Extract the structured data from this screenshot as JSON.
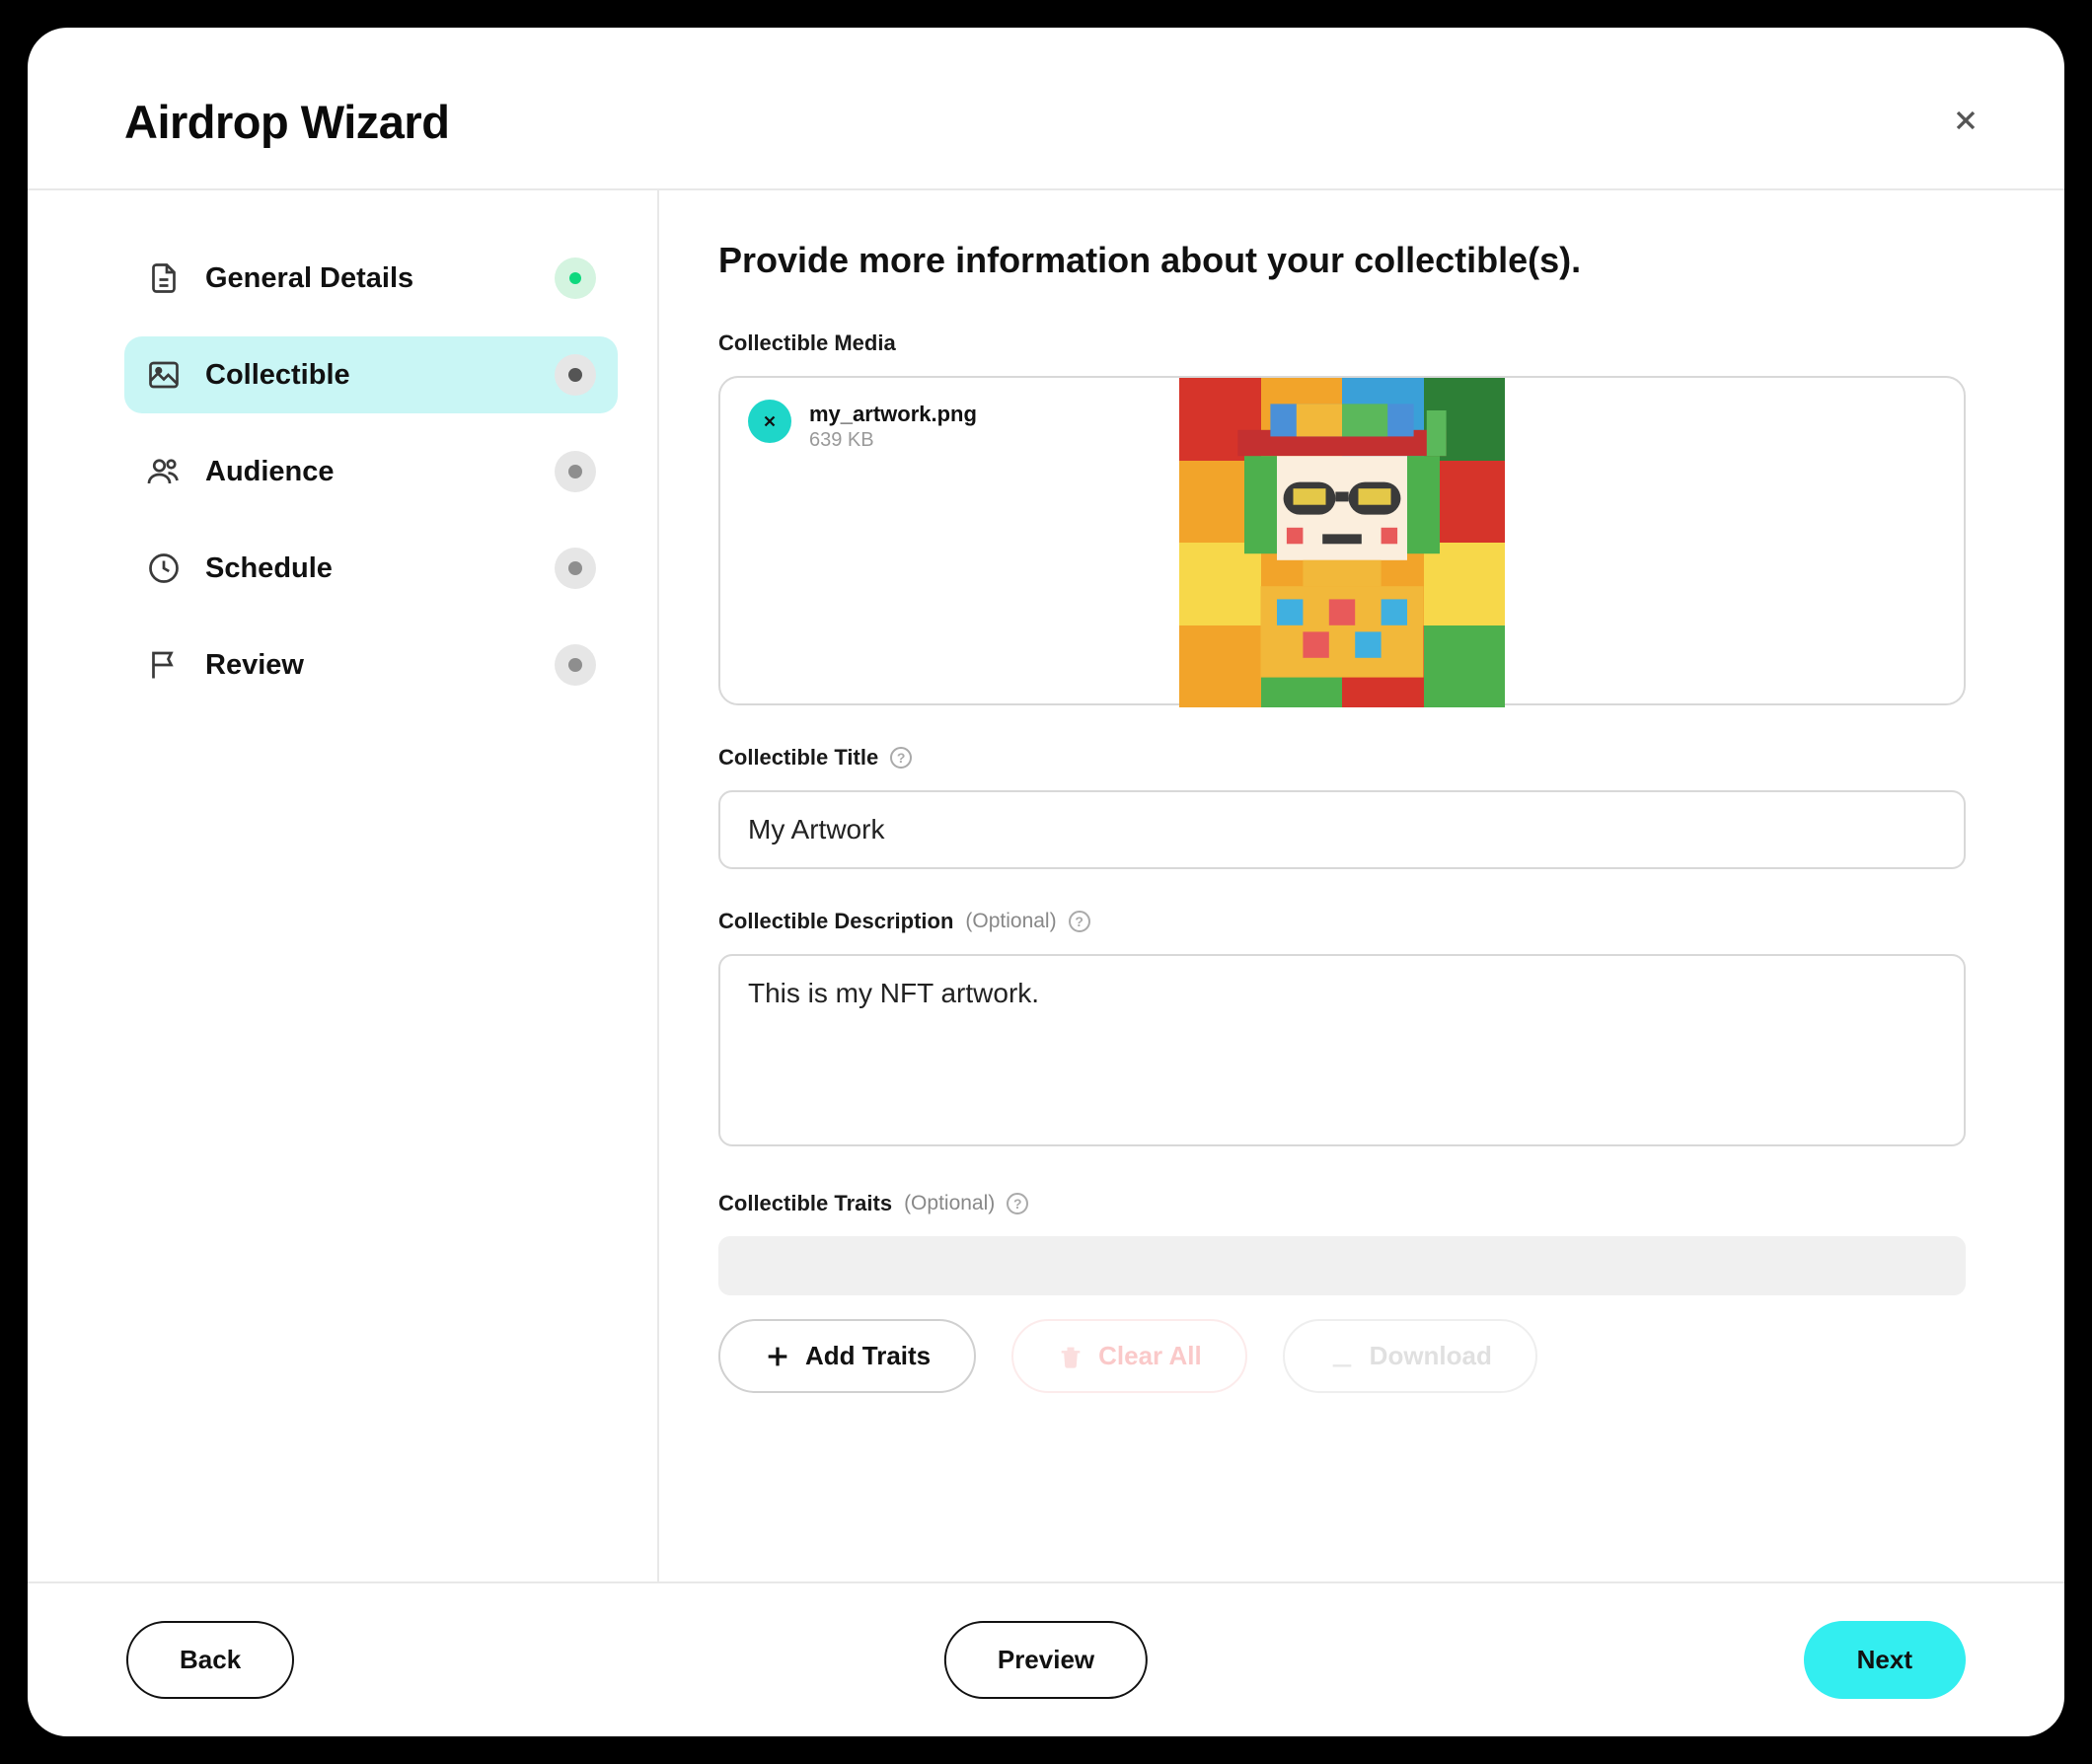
{
  "modal": {
    "title": "Airdrop Wizard"
  },
  "sidebar": {
    "steps": [
      {
        "label": "General Details",
        "status": "complete"
      },
      {
        "label": "Collectible",
        "status": "active"
      },
      {
        "label": "Audience",
        "status": "pending"
      },
      {
        "label": "Schedule",
        "status": "pending"
      },
      {
        "label": "Review",
        "status": "pending"
      }
    ]
  },
  "content": {
    "heading": "Provide more information about your collectible(s).",
    "media": {
      "label": "Collectible Media",
      "file_name": "my_artwork.png",
      "file_size": "639 KB"
    },
    "title_field": {
      "label": "Collectible Title",
      "value": "My Artwork"
    },
    "description_field": {
      "label": "Collectible Description",
      "optional": "(Optional)",
      "value": "This is my NFT artwork."
    },
    "traits_field": {
      "label": "Collectible Traits",
      "optional": "(Optional)",
      "add_btn": "Add Traits",
      "clear_btn": "Clear All",
      "download_btn": "Download"
    }
  },
  "footer": {
    "back": "Back",
    "preview": "Preview",
    "next": "Next"
  }
}
